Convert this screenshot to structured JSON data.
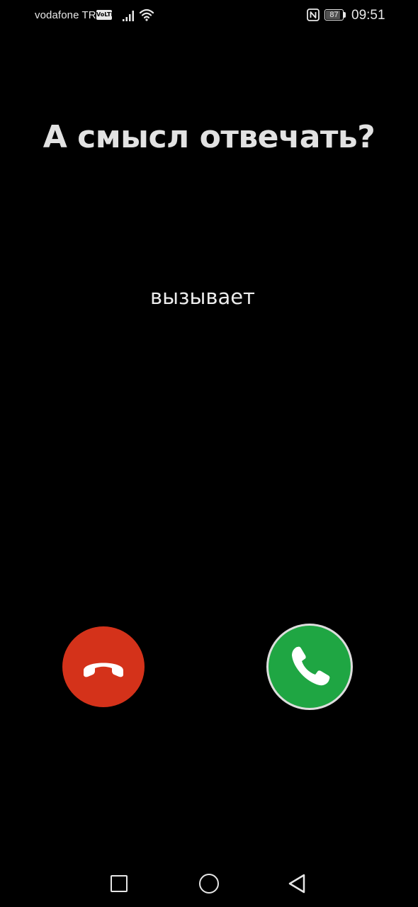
{
  "status_bar": {
    "carrier": "vodafone TR",
    "volte_badge": "VoLTE",
    "battery_level": "87",
    "battery_fraction": 0.87,
    "time": "09:51",
    "icons": [
      "signal-icon",
      "wifi-icon",
      "nfc-icon",
      "battery-icon"
    ]
  },
  "call_screen": {
    "caption": "А смысл отвечать?",
    "status": "вызывает",
    "decline": {
      "icon": "phone-hangup-icon",
      "color": "#d4321a"
    },
    "answer": {
      "icon": "phone-icon",
      "color": "#1fa643"
    }
  },
  "nav_bar": {
    "recent": "square-icon",
    "home": "circle-icon",
    "back": "triangle-back-icon"
  }
}
